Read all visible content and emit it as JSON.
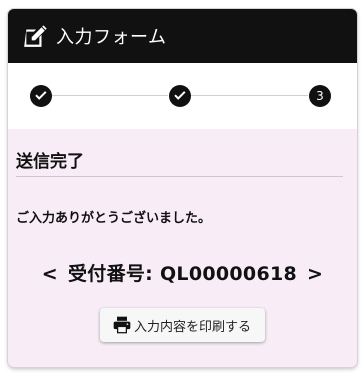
{
  "header": {
    "title": "入力フォーム",
    "icon": "edit-icon"
  },
  "stepper": {
    "steps": [
      {
        "state": "completed",
        "icon": "check-icon",
        "label": ""
      },
      {
        "state": "completed",
        "icon": "check-icon",
        "label": ""
      },
      {
        "state": "current",
        "label": "3"
      }
    ]
  },
  "main": {
    "section_title": "送信完了",
    "message": "ご入力ありがとうございました。",
    "receipt": {
      "open": "<",
      "label": "受付番号: QL00000618",
      "close": ">"
    },
    "print_button": {
      "label": "入力内容を印刷する",
      "icon": "printer-icon"
    }
  },
  "colors": {
    "header_bg": "#111111",
    "body_bg": "#f8edf7",
    "step_active": "#111111"
  }
}
